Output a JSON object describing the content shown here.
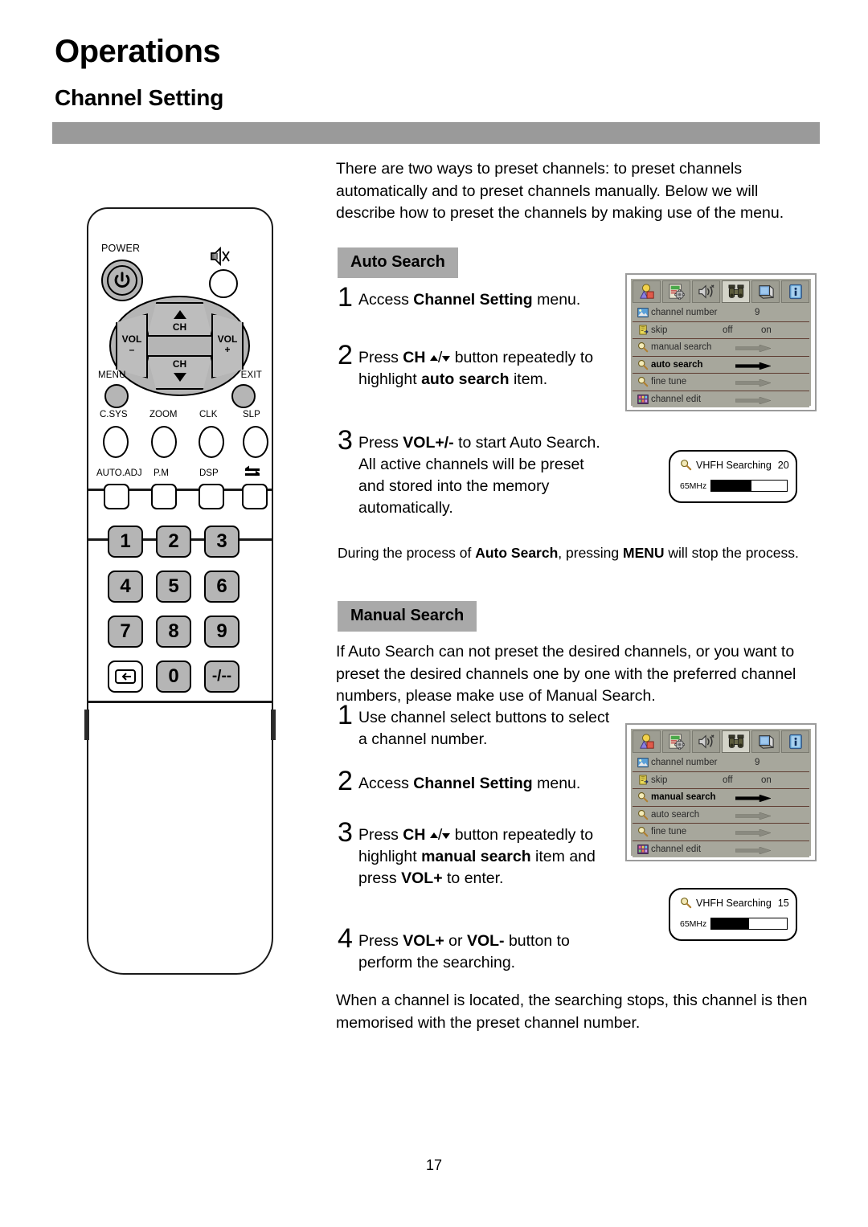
{
  "header": {
    "chapter": "Operations",
    "section": "Channel Setting"
  },
  "intro_paragraph": "There are two ways to preset channels: to preset channels automatically and to preset channels manually. Below we will describe how to preset the channels by making use of the menu.",
  "auto_search": {
    "heading": "Auto Search",
    "steps": [
      {
        "num": "1",
        "text_html": "Access <b>Channel Setting</b> menu."
      },
      {
        "num": "2",
        "text_html": "Press <b>CH</b> <span class=\"arrow-up\"></span>/<span class=\"arrow-down\"></span> button repeatedly to highlight <b>auto search</b> item."
      },
      {
        "num": "3",
        "text_html": "Press <b>VOL+/-</b> to start Auto Search.<br>All active channels will be preset and stored into the memory automatically."
      }
    ],
    "note_html": "During the process of <b>Auto Search</b>, pressing <b>MENU</b> will stop the process."
  },
  "manual_search": {
    "heading": "Manual Search",
    "intro": "If Auto Search can not preset the desired channels, or you want to preset the desired channels one by one with the preferred channel numbers, please make use of Manual Search.",
    "steps": [
      {
        "num": "1",
        "text_html": "Use channel select buttons to select a channel number."
      },
      {
        "num": "2",
        "text_html": "Access <b>Channel Setting</b> menu."
      },
      {
        "num": "3",
        "text_html": "Press <b>CH</b> <span class=\"arrow-up\"></span>/<span class=\"arrow-down\"></span> button repeatedly to highlight <b>manual search</b> item and press <b>VOL+</b> to enter."
      },
      {
        "num": "4",
        "text_html": "Press <b>VOL+</b> or <b>VOL-</b> button to perform the searching."
      }
    ]
  },
  "closing_paragraph": "When a channel is located, the searching stops, this channel is then memorised with the preset channel number.",
  "osd_menu": {
    "tabs": [
      {
        "name": "picture-tab",
        "icon": "colored-shapes-icon"
      },
      {
        "name": "setup-tab",
        "icon": "gear-icon"
      },
      {
        "name": "sound-tab",
        "icon": "speaker-icon"
      },
      {
        "name": "channel-tab",
        "icon": "binoculars-icon"
      },
      {
        "name": "display-tab",
        "icon": "screen-icon"
      },
      {
        "name": "info-tab",
        "icon": "info-icon"
      }
    ],
    "rows": [
      {
        "label": "channel number",
        "icon": "picture-icon",
        "value": "9",
        "kind": "value"
      },
      {
        "label": "skip",
        "icon": "skip-icon",
        "off": "off",
        "on": "on",
        "kind": "toggle"
      },
      {
        "label": "manual search",
        "icon": "magnifier-icon",
        "kind": "arrow"
      },
      {
        "label": "auto search",
        "icon": "magnifier-icon",
        "kind": "arrow"
      },
      {
        "label": "fine tune",
        "icon": "magnifier-icon",
        "kind": "arrow"
      },
      {
        "label": "channel edit",
        "icon": "grid-icon",
        "kind": "arrow"
      }
    ],
    "auto_selected_index": 3,
    "manual_selected_index": 2
  },
  "search_status": {
    "auto": {
      "icon": "magnifier-icon",
      "label": "VHFH Searching",
      "channel": "20",
      "frequency": "65MHz",
      "progress_percent": 53
    },
    "manual": {
      "icon": "magnifier-icon",
      "label": "VHFH Searching",
      "channel": "15",
      "frequency": "65MHz",
      "progress_percent": 50
    }
  },
  "remote": {
    "power_label": "POWER",
    "mute_icon": "mute-icon",
    "dpad": {
      "ch_up": "CH",
      "ch_down": "CH",
      "vol_minus_top": "VOL",
      "vol_minus_bottom": "–",
      "vol_plus_top": "VOL",
      "vol_plus_bottom": "+"
    },
    "menu_label": "MENU",
    "exit_label": "EXIT",
    "function_row_1": [
      "C.SYS",
      "ZOOM",
      "CLK",
      "SLP"
    ],
    "function_row_2": [
      "AUTO.ADJ",
      "P.M",
      "DSP"
    ],
    "swap_icon": "swap-icon",
    "keypad": [
      "1",
      "2",
      "3",
      "4",
      "5",
      "6",
      "7",
      "8",
      "9",
      "input-icon",
      "0",
      "-/--"
    ]
  },
  "page_number": "17",
  "colors": {
    "header_bar": "#9a9a9a",
    "section_label_bg": "#a9a9a9",
    "osd_row_bg": "#a7a79c",
    "osd_tab_active": "#d3d3c8",
    "osd_divider": "#5e3b30",
    "remote_button_gray": "#b5b5b5"
  }
}
